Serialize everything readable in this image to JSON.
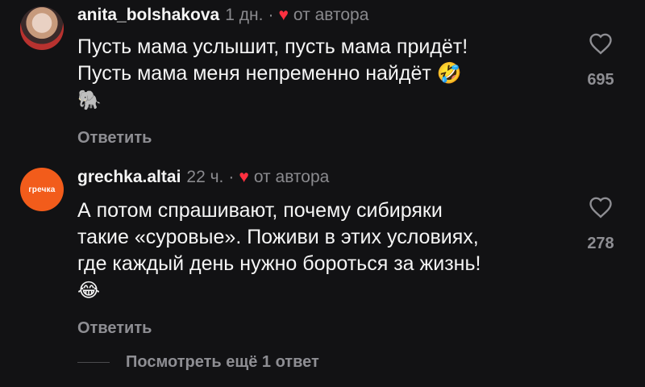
{
  "comments": [
    {
      "username": "anita_bolshakova",
      "time": "1 дн.",
      "separator": "·",
      "author_badge": "от автора",
      "text_lines": [
        "Пусть мама услышит, пусть мама придёт!",
        "Пусть мама меня непременно найдёт 🤣",
        "🐘"
      ],
      "reply_label": "Ответить",
      "likes": "695",
      "avatar_icon": "person-photo"
    },
    {
      "username": "grechka.altai",
      "time": "22 ч.",
      "separator": "·",
      "author_badge": "от автора",
      "text_lines": [
        "А потом спрашивают, почему сибиряки",
        "такие «суровые». Поживи в этих условиях,",
        "где каждый день нужно бороться за жизнь!",
        "😂"
      ],
      "reply_label": "Ответить",
      "likes": "278",
      "avatar_text": "гречка"
    }
  ],
  "more_replies": "Посмотреть ещё 1 ответ",
  "colors": {
    "background": "#121214",
    "heart": "#ff3040",
    "muted": "#8e8e93"
  }
}
